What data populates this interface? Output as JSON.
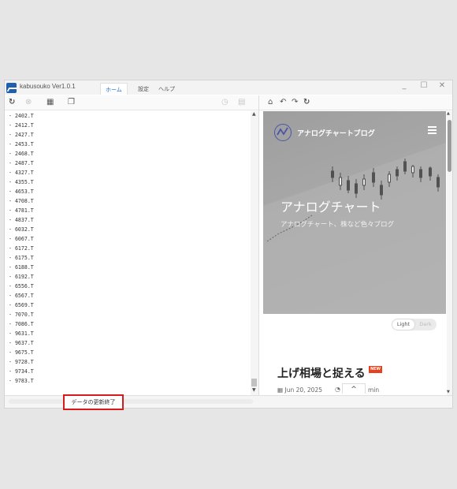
{
  "app": {
    "title": "kabusouko Ver1.0.1"
  },
  "tabs": [
    {
      "label": "ホーム",
      "active": true
    },
    {
      "label": "設定",
      "active": false
    },
    {
      "label": "ヘルプ",
      "active": false
    }
  ],
  "window_controls": {
    "minimize": "_",
    "maximize": "☐",
    "close": "✕"
  },
  "toolbar_left": {
    "icons": [
      "refresh-icon",
      "cancel-icon",
      "grid-icon",
      "copy-icon",
      "clock-icon",
      "document-icon"
    ]
  },
  "toolbar_right": {
    "icons": [
      "home-icon",
      "undo-icon",
      "redo-icon",
      "reload-icon"
    ]
  },
  "ticker_list": [
    "- 2402.T",
    "- 2412.T",
    "- 2427.T",
    "- 2453.T",
    "- 2468.T",
    "- 2487.T",
    "- 4327.T",
    "- 4355.T",
    "- 4653.T",
    "- 4708.T",
    "- 4781.T",
    "- 4837.T",
    "- 6032.T",
    "- 6067.T",
    "- 6172.T",
    "- 6175.T",
    "- 6188.T",
    "- 6192.T",
    "- 6556.T",
    "- 6567.T",
    "- 6569.T",
    "- 7070.T",
    "- 7086.T",
    "- 9631.T",
    "- 9637.T",
    "- 9675.T",
    "- 9728.T",
    "- 9734.T",
    "- 9783.T"
  ],
  "status": {
    "message": "データの更新終了"
  },
  "browser": {
    "site_name": "アナログチャートブログ",
    "hero_title": "アナログチャート",
    "hero_subtitle": "アナログチャート、株など色々ブログ",
    "theme_toggle": {
      "light": "Light",
      "dark": "Dark",
      "selected": "Light"
    },
    "post": {
      "title": "上げ相場と捉える",
      "badge": "NEW",
      "date": "Jun 20, 2025",
      "author_suffix": "min"
    },
    "scroll_top_label": "^"
  },
  "colors": {
    "accent": "#1f6fd0",
    "status_border": "#d71a1a",
    "badge": "#e8401c",
    "logo": "#4b55a6"
  }
}
